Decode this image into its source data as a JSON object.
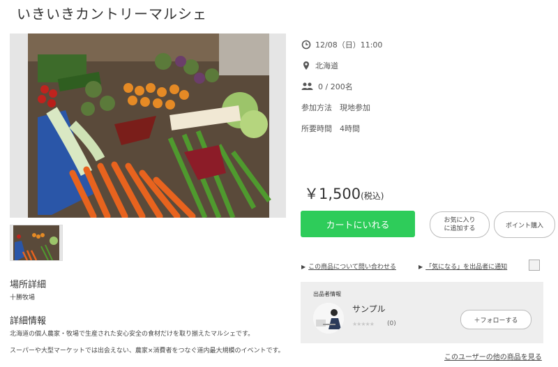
{
  "title": "いきいきカントリーマルシェ",
  "event": {
    "datetime": "12/08（日）11:00",
    "location": "北海道",
    "capacity": "0 / 200名",
    "participation": "参加方法　現地参加",
    "duration": "所要時間　4時間"
  },
  "price": {
    "amount": "￥1,500",
    "tax": "(税込)"
  },
  "buttons": {
    "cart": "カートにいれる",
    "favorite_l1": "お気に入り",
    "favorite_l2": "に追加する",
    "points": "ポイント購入"
  },
  "links": {
    "inquiry": "この商品について問い合わせる",
    "notify": "「気になる」を出品者に通知"
  },
  "seller": {
    "label": "出品者情報",
    "name": "サンプル",
    "stars": "★★★★★",
    "reviews": "(0)",
    "follow": "＋フォローする",
    "others": "このユーザーの他の商品を見る"
  },
  "sections": {
    "place_heading": "場所詳細",
    "place_text": "十勝牧場",
    "detail_heading": "詳細情報",
    "detail_p1": "北海道の個人農家・牧場で生産された安心安全の食材だけを取り揃えたマルシェです。",
    "detail_p2": "スーパーや大型マーケットでは出会えない、農家×消費者をつなぐ道内最大規模のイベントです。"
  },
  "icons": [
    "clock-icon",
    "location-pin-icon",
    "people-icon",
    "broken-image-icon"
  ],
  "colors": {
    "cart": "#2ecc5a",
    "seller_bg": "#eeeeee"
  }
}
